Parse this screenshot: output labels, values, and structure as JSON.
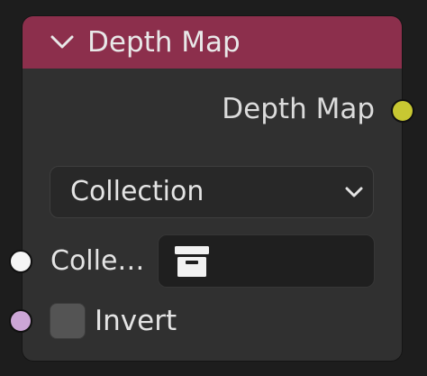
{
  "node": {
    "title": "Depth Map",
    "header_color": "#8c2f4c",
    "body_color": "#303030",
    "collapse_icon": "chevron-down-icon",
    "output": {
      "label": "Depth Map",
      "socket_color": "#c8c832"
    },
    "mode_select": {
      "value": "Collection",
      "arrow_icon": "chevron-down-icon"
    },
    "collection_input": {
      "label": "Colle…",
      "socket_color": "#f5f5f5",
      "icon": "collection-box-icon"
    },
    "invert": {
      "label": "Invert",
      "checked": false,
      "socket_color": "#cca6d6"
    }
  }
}
